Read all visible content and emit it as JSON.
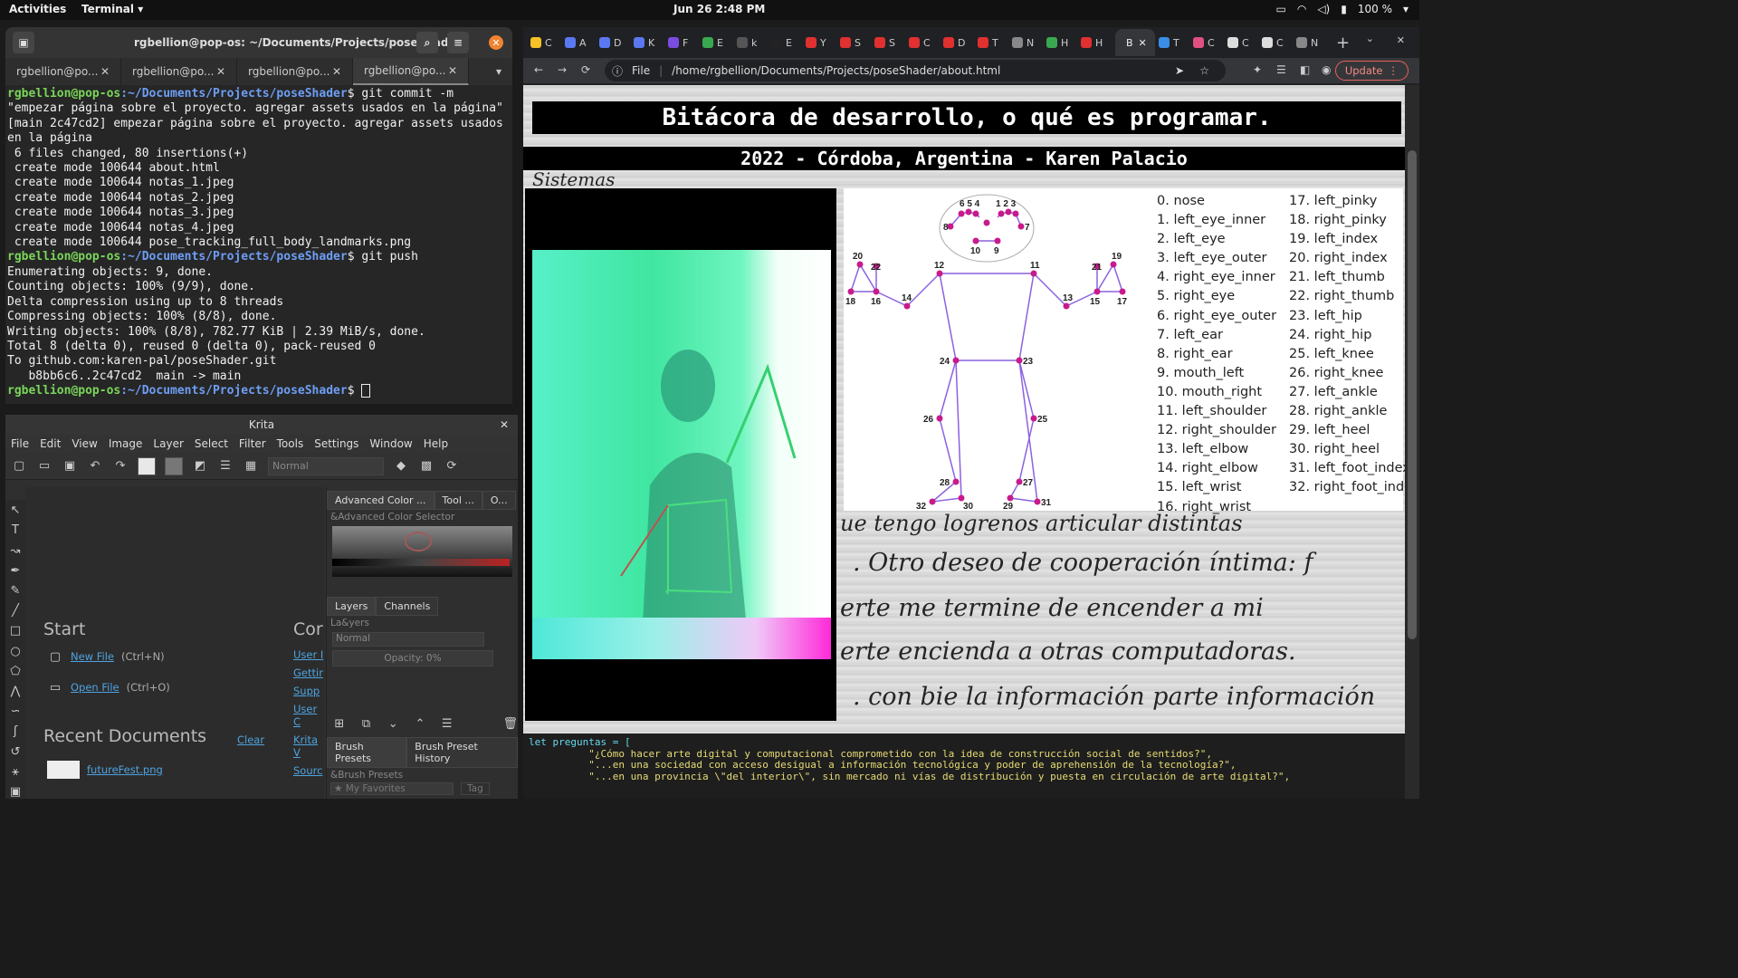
{
  "topbar": {
    "activities": "Activities",
    "app_menu": "Terminal ▾",
    "clock": "Jun 26  2:48 PM",
    "battery": "100 %"
  },
  "terminal": {
    "title": "rgbellion@pop-os: ~/Documents/Projects/poseShader",
    "tabs": [
      "rgbellion@po...",
      "rgbellion@po...",
      "rgbellion@po...",
      "rgbellion@po..."
    ],
    "prompt_user": "rgbellion@pop-os",
    "prompt_path": ":~/Documents/Projects/poseShader",
    "cmd1": "$ git commit -m \"empezar página sobre el proyecto. agregar assets usados en la página\"",
    "out1": [
      "[main 2c47cd2] empezar página sobre el proyecto. agregar assets usados en la página",
      " 6 files changed, 80 insertions(+)",
      " create mode 100644 about.html",
      " create mode 100644 notas_1.jpeg",
      " create mode 100644 notas_2.jpeg",
      " create mode 100644 notas_3.jpeg",
      " create mode 100644 notas_4.jpeg",
      " create mode 100644 pose_tracking_full_body_landmarks.png"
    ],
    "cmd2": "$ git push",
    "out2": [
      "Enumerating objects: 9, done.",
      "Counting objects: 100% (9/9), done.",
      "Delta compression using up to 8 threads",
      "Compressing objects: 100% (8/8), done.",
      "Writing objects: 100% (8/8), 782.77 KiB | 2.39 MiB/s, done.",
      "Total 8 (delta 0), reused 0 (delta 0), pack-reused 0",
      "To github.com:karen-pal/poseShader.git",
      "   b8bb6c6..2c47cd2  main -> main"
    ],
    "cmd3": "$ "
  },
  "krita": {
    "title": "Krita",
    "menu": [
      "File",
      "Edit",
      "View",
      "Image",
      "Layer",
      "Select",
      "Filter",
      "Tools",
      "Settings",
      "Window",
      "Help"
    ],
    "blend_mode": "Normal",
    "start_heading": "Start",
    "new_file": "New File",
    "new_file_shortcut": "(Ctrl+N)",
    "open_file": "Open File",
    "open_file_shortcut": "(Ctrl+O)",
    "community_heading": "Cor",
    "community_links": [
      "User I",
      "Gettir",
      "Supp",
      "User C",
      "Krita V",
      "Sourc"
    ],
    "recent_heading": "Recent Documents",
    "clear": "Clear",
    "recent_files": [
      "futureFest.png"
    ],
    "dock_tabs": [
      "Advanced Color ...",
      "Tool ...",
      "O..."
    ],
    "adv_color_header": "&Advanced Color Selector",
    "layers_tabs": [
      "Layers",
      "Channels"
    ],
    "layers_header": "La&yers",
    "layer_blend": "Normal",
    "opacity": "Opacity:  0%",
    "brush_tabs": [
      "Brush Presets",
      "Brush Preset History"
    ],
    "brush_header": "&Brush Presets",
    "favorites": "★ My Favorites",
    "tag": "Tag"
  },
  "browser": {
    "tab_letters": [
      "C",
      "A",
      "D",
      "K",
      "F",
      "E",
      "k",
      "E",
      "Y",
      "S",
      "S",
      "C",
      "D",
      "T",
      "N",
      "H",
      "H",
      "B",
      "T",
      "C",
      "C",
      "C",
      "N"
    ],
    "file_label": "File",
    "url": "/home/rgbellion/Documents/Projects/poseShader/about.html",
    "update": "Update"
  },
  "page": {
    "title": "Bitácora de desarrollo, o qué es programar.",
    "subtitle": "2022 - Córdoba, Argentina - Karen Palacio",
    "landmarks_col1": [
      "0. nose",
      "1. left_eye_inner",
      "2. left_eye",
      "3. left_eye_outer",
      "4. right_eye_inner",
      "5. right_eye",
      "6. right_eye_outer",
      "7. left_ear",
      "8. right_ear",
      "9. mouth_left",
      "10. mouth_right",
      "11. left_shoulder",
      "12. right_shoulder",
      "13. left_elbow",
      "14. right_elbow",
      "15. left_wrist",
      "16. right_wrist"
    ],
    "landmarks_col2": [
      "17. left_pinky",
      "18. right_pinky",
      "19. left_index",
      "20. right_index",
      "21. left_thumb",
      "22. right_thumb",
      "23. left_hip",
      "24. right_hip",
      "25. left_knee",
      "26. right_knee",
      "27. left_ankle",
      "28. right_ankle",
      "29. left_heel",
      "30. right_heel",
      "31. left_foot_index",
      "32. right_foot_inde"
    ],
    "notes": [
      "ue tengo logrenos articular distintas",
      ". Otro deseo de cooperación íntima: f",
      "erte me termine de encender a mi",
      "erte encienda a otras computadoras.",
      ". con bie la información parte información"
    ],
    "code_lines": [
      "let preguntas = [",
      "          \"¿Cómo hacer arte digital y computacional comprometido con la idea de construcción social de sentidos?\",",
      "          \"...en una sociedad con acceso desigual a información tecnológica y poder de aprehensión de la tecnología?\",",
      "          \"...en una provincia \\\"del interior\\\", sin mercado ni vías de distribución y puesta en circulación de arte digital?\","
    ]
  }
}
